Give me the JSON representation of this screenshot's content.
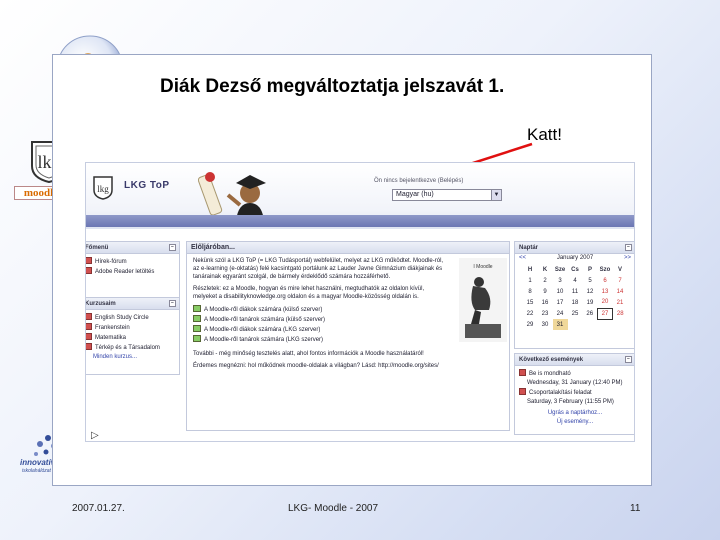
{
  "slide": {
    "title": "Diák Dezső megváltoztatja jelszavát 1.",
    "callout": "Katt!",
    "footer_date": "2007.01.27.",
    "footer_center": "LKG- Moodle - 2007",
    "page_number": "11",
    "arrow_color": "#e01010"
  },
  "side_logos": {
    "moodle": "moodle",
    "innovativ": "innovatív",
    "innovativ_sub": "iskolahálózat"
  },
  "site": {
    "name": "LKG ToP",
    "login_info": "Ön nincs bejelentkezve (Belépés)",
    "language": "Magyar (hu)",
    "main_menu": {
      "title": "Főmenü",
      "items": [
        "Hírek-fórum",
        "Adobe Reader letöltés"
      ]
    },
    "courses": {
      "title": "Kurzusaim",
      "items": [
        "English Study Circle",
        "Frankenstein",
        "Matematika",
        "Térkép és a Társadalom",
        "Minden kurzus..."
      ]
    },
    "center": {
      "title": "Előljáróban...",
      "para1": "Nekünk szól a LKG ToP (= LKG Tudásportál) webfelület, melyet az LKG működtet. Moodle-ról, az e-learning (e-oktatás) felé kacsintgató portálunk az Lauder Javne Gimnázium diákjainak és tanárainak egyaránt szolgál, de bármely érdeklődő számára hozzáférhető.",
      "para2": "Részletek: ez a Moodle, hogyan és mire lehet használni, megtudhatók az oldalon kívül, melyeket a disabilityknowledge.org oldalon és a magyar Moodle-közösség oldalán is.",
      "links": [
        "A Moodle-ről diákok számára (külső szerver)",
        "A Moodle-ről tanárok számára (külső szerver)",
        "A Moodle-ről diákok számára (LKG szerver)",
        "A Moodle-ről tanárok számára (LKG szerver)"
      ],
      "para3": "További - még minőség tesztelés alatt, ahol fontos információk a Moodle használatáról!",
      "para4": "Érdemes megnézni: hol működnek moodle-oldalak a világban? Lásd: http://moodle.org/sites/",
      "thinker_label": "I Moodle"
    },
    "calendar": {
      "title": "Naptár",
      "month": "January 2007",
      "prev": "<<",
      "next": ">>",
      "weekdays": [
        "H",
        "K",
        "Sze",
        "Cs",
        "P",
        "Szo",
        "V"
      ],
      "weeks": [
        [
          "1",
          "2",
          "3",
          "4",
          "5",
          "6",
          "7"
        ],
        [
          "8",
          "9",
          "10",
          "11",
          "12",
          "13",
          "14"
        ],
        [
          "15",
          "16",
          "17",
          "18",
          "19",
          "20",
          "21"
        ],
        [
          "22",
          "23",
          "24",
          "25",
          "26",
          "27",
          "28"
        ],
        [
          "29",
          "30",
          "31",
          "",
          "",
          "",
          ""
        ]
      ],
      "today": "27",
      "event_day": "31"
    },
    "events": {
      "title": "Következő események",
      "items": [
        "Be is mondható",
        "Wednesday, 31 January (12:40 PM)",
        "Csoportalakítási feladat",
        "Saturday, 3 February (11:55 PM)"
      ],
      "goto": "Ugrás a naptárhoz...",
      "new": "Új esemény..."
    }
  }
}
